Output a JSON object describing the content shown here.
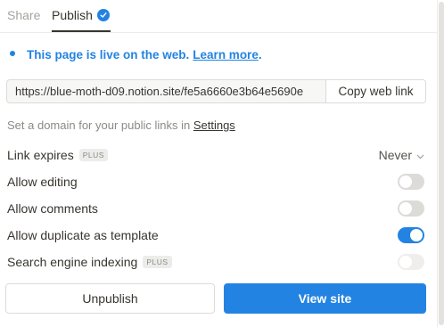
{
  "tabs": {
    "share_label": "Share",
    "publish_label": "Publish"
  },
  "live_notice": {
    "message": "This page is live on the web.",
    "link_text": "Learn more",
    "suffix": "."
  },
  "url": {
    "value": "https://blue-moth-d09.notion.site/fe5a6660e3b64e5690e",
    "copy_label": "Copy web link"
  },
  "domain": {
    "text": "Set a domain for your public links in ",
    "settings_link": "Settings"
  },
  "options": {
    "link_expires": {
      "label": "Link expires",
      "badge": "PLUS",
      "value": "Never"
    },
    "allow_editing": {
      "label": "Allow editing",
      "on": false
    },
    "allow_comments": {
      "label": "Allow comments",
      "on": false
    },
    "allow_duplicate": {
      "label": "Allow duplicate as template",
      "on": true
    },
    "search_indexing": {
      "label": "Search engine indexing",
      "badge": "PLUS",
      "on": false,
      "disabled": true
    }
  },
  "actions": {
    "unpublish_label": "Unpublish",
    "view_site_label": "View site"
  },
  "colors": {
    "accent": "#2383e2",
    "text": "#37352f",
    "muted": "#8c8a85"
  }
}
